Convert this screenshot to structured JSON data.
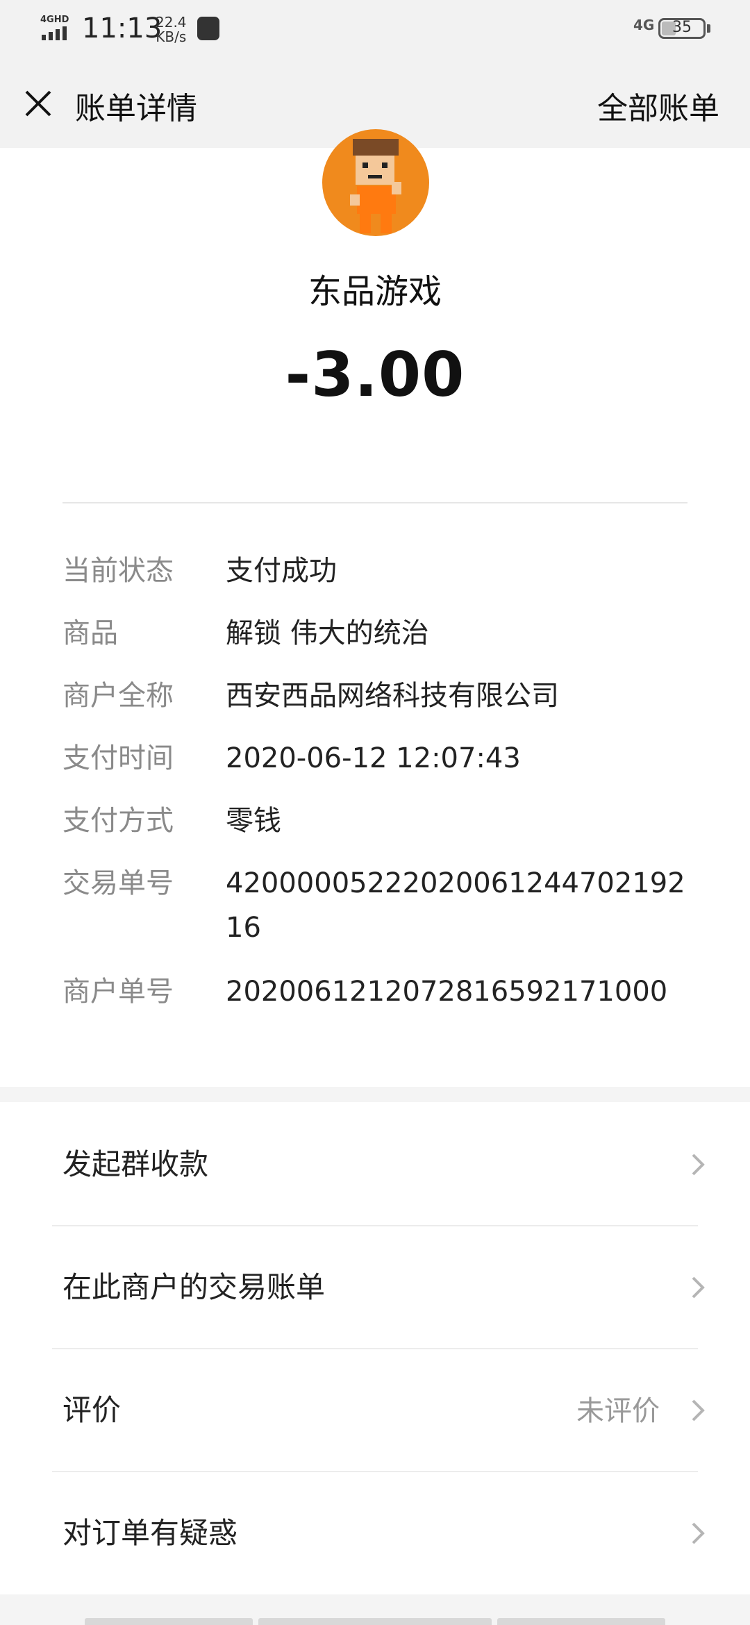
{
  "status_bar": {
    "network": "4GHD",
    "time": "11:13",
    "speed_value": "22.4",
    "speed_unit": "KB/s",
    "network_right": "4G",
    "battery": "35",
    "battery_level": 0.35
  },
  "header": {
    "title": "账单详情",
    "right_link": "全部账单"
  },
  "merchant": {
    "name": "东品游戏",
    "amount": "-3.00",
    "avatar_icon": "game-character-avatar",
    "avatar_color": "#f08a1d"
  },
  "details": [
    {
      "label": "当前状态",
      "value": "支付成功"
    },
    {
      "label": "商品",
      "value": "解锁 伟大的统治"
    },
    {
      "label": "商户全称",
      "value": "西安西品网络科技有限公司"
    },
    {
      "label": "支付时间",
      "value": "2020-06-12 12:07:43"
    },
    {
      "label": "支付方式",
      "value": "零钱"
    },
    {
      "label": "交易单号",
      "value": "4200000522202006124470219216"
    },
    {
      "label": "商户单号",
      "value": "2020061212072816592171000"
    }
  ],
  "menu": [
    {
      "label": "发起群收款",
      "sub": ""
    },
    {
      "label": "在此商户的交易账单",
      "sub": ""
    },
    {
      "label": "评价",
      "sub": "未评价"
    },
    {
      "label": "对订单有疑惑",
      "sub": ""
    }
  ]
}
